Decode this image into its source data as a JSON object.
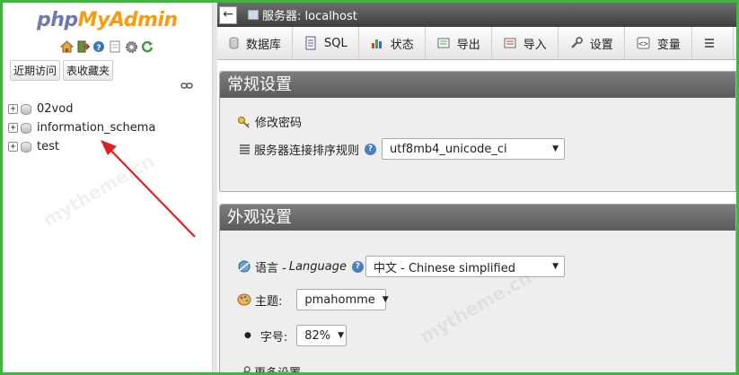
{
  "nav": {
    "logo_php": "php",
    "logo_rest": "MyAdmin",
    "icons": [
      "home-icon",
      "logout-icon",
      "help-icon",
      "docs-icon",
      "settings-icon",
      "reload-icon"
    ],
    "tabs": [
      {
        "label": "近期访问"
      },
      {
        "label": "表收藏夹"
      }
    ],
    "databases": [
      {
        "name": "02vod"
      },
      {
        "name": "information_schema"
      },
      {
        "name": "test"
      }
    ]
  },
  "topbar": {
    "server_label": "服务器: localhost"
  },
  "tabs": [
    {
      "label": "数据库",
      "icon": "database-icon"
    },
    {
      "label": "SQL",
      "icon": "sql-icon"
    },
    {
      "label": "状态",
      "icon": "status-icon"
    },
    {
      "label": "导出",
      "icon": "export-icon"
    },
    {
      "label": "导入",
      "icon": "import-icon"
    },
    {
      "label": "设置",
      "icon": "wrench-icon"
    },
    {
      "label": "变量",
      "icon": "variables-icon"
    },
    {
      "label": "",
      "icon": "more-icon"
    }
  ],
  "general": {
    "title": "常规设置",
    "change_password": "修改密码",
    "collation_label": "服务器连接排序规则",
    "collation_value": "utf8mb4_unicode_ci"
  },
  "appearance": {
    "title": "外观设置",
    "language_label": "语言 - ",
    "language_label_en": "Language",
    "language_value": "中文 - Chinese simplified",
    "theme_label": "主题:",
    "theme_value": "pmahomme",
    "fontsize_label": "字号:",
    "fontsize_value": "82%",
    "more_settings": "更多设置"
  },
  "watermark": "mytheme.cn",
  "colors": {
    "frame": "#3cb83c",
    "logo_php": "#6c78af",
    "logo_admin": "#f89c0e",
    "arrow": "#e02020"
  }
}
